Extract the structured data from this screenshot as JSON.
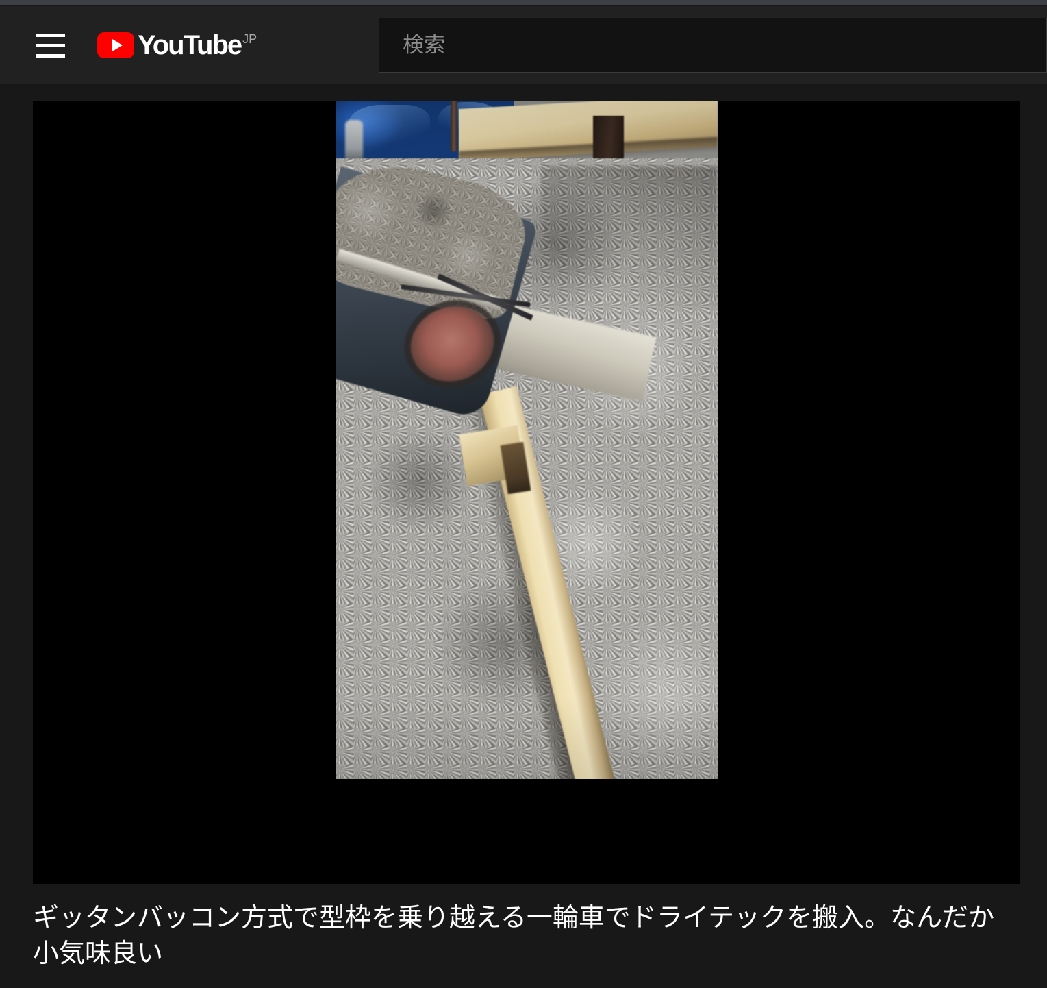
{
  "browser": {
    "chrome_strip_color": "#3c3f46"
  },
  "masthead": {
    "guide_label": "guide-menu",
    "logo": {
      "wordmark": "YouTube",
      "country_code": "JP",
      "brand_color": "#ff0000"
    },
    "search": {
      "placeholder": "検索",
      "value": ""
    }
  },
  "player": {
    "state": "paused",
    "background_color": "#000000"
  },
  "video": {
    "title": "ギッタンバッコン方式で型枠を乗り越える一輪車でドライテックを搬入。なんだか小気味良い"
  },
  "theme": {
    "page_background": "#181818",
    "masthead_background": "#212121",
    "search_background": "#121212",
    "search_border": "#3b3b3b",
    "text_primary": "#ffffff",
    "text_secondary": "#aaaaaa",
    "placeholder_color": "#8b8b8b"
  }
}
